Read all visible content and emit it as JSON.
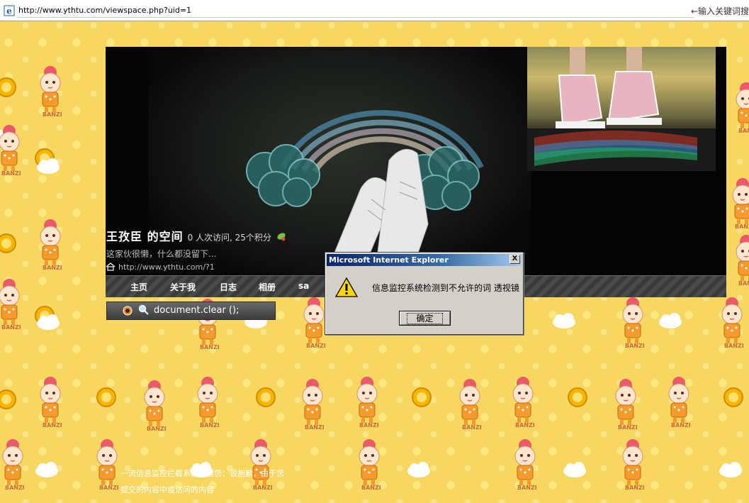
{
  "browser": {
    "url": "http://www.ythtu.com/viewspace.php?uid=1",
    "keyword_hint": "←输入关键词搜"
  },
  "space": {
    "title": "王孜臣  的空间",
    "stats": "0 人次访问, 25个积分",
    "motto": "这家伙很懒，什么都没留下...",
    "home_url": "http://www.ythtu.com/?1"
  },
  "nav": {
    "items": [
      "主页",
      "关于我",
      "日志",
      "相册",
      "sa"
    ]
  },
  "script_bar": {
    "code": "document.clear ();"
  },
  "footer": {
    "text": "一流信息监控拦截系统提醒您：很抱歉，由于您提交的内容中或访问的内容"
  },
  "dialog": {
    "title": "Microsoft Internet Explorer",
    "close_label": "X",
    "message": "信息监控系统检测到不允许的词 透视镜",
    "ok_label": "确定"
  },
  "colors": {
    "background": "#f7d760",
    "banner": "#050505",
    "dialog_title": "#0a246a",
    "dialog_body": "#d4d0c8"
  }
}
